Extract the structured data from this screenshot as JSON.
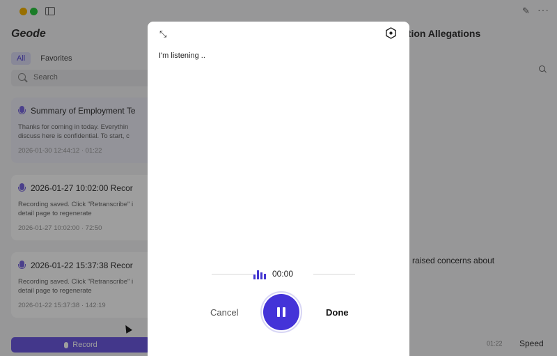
{
  "sidebar": {
    "app_title": "Geode",
    "tabs": [
      {
        "label": "All"
      },
      {
        "label": "Favorites"
      }
    ],
    "search_placeholder": "Search",
    "recordings": [
      {
        "title": "Summary of Employment Te",
        "body": " Thanks for coming in today. Everythin\ndiscuss here is confidential. To start, c",
        "meta": "2026-01-30 12:44:12 · 01:22"
      },
      {
        "title": "2026-01-27 10:02:00 Recor",
        "body": "Recording saved. Click \"Retranscribe\" i\ndetail page to regenerate",
        "meta": "2026-01-27 10:02:00 · 72:50"
      },
      {
        "title": "2026-01-22 15:37:38 Recor",
        "body": "Recording saved. Click \"Retranscribe\" i\ndetail page to regenerate",
        "meta": "2026-01-22 15:37:38 · 142:19"
      }
    ],
    "record_label": "Record"
  },
  "main": {
    "title": "ation Allegations",
    "text_fragment": "r I raised concerns about",
    "speed_label": "Speed",
    "time_fragment": "01:22"
  },
  "modal": {
    "status_text": "I'm listening ..",
    "timer": "00:00",
    "cancel_label": "Cancel",
    "done_label": "Done"
  },
  "colors": {
    "accent": "#4433d8",
    "record_button": "#6d5ae0"
  }
}
